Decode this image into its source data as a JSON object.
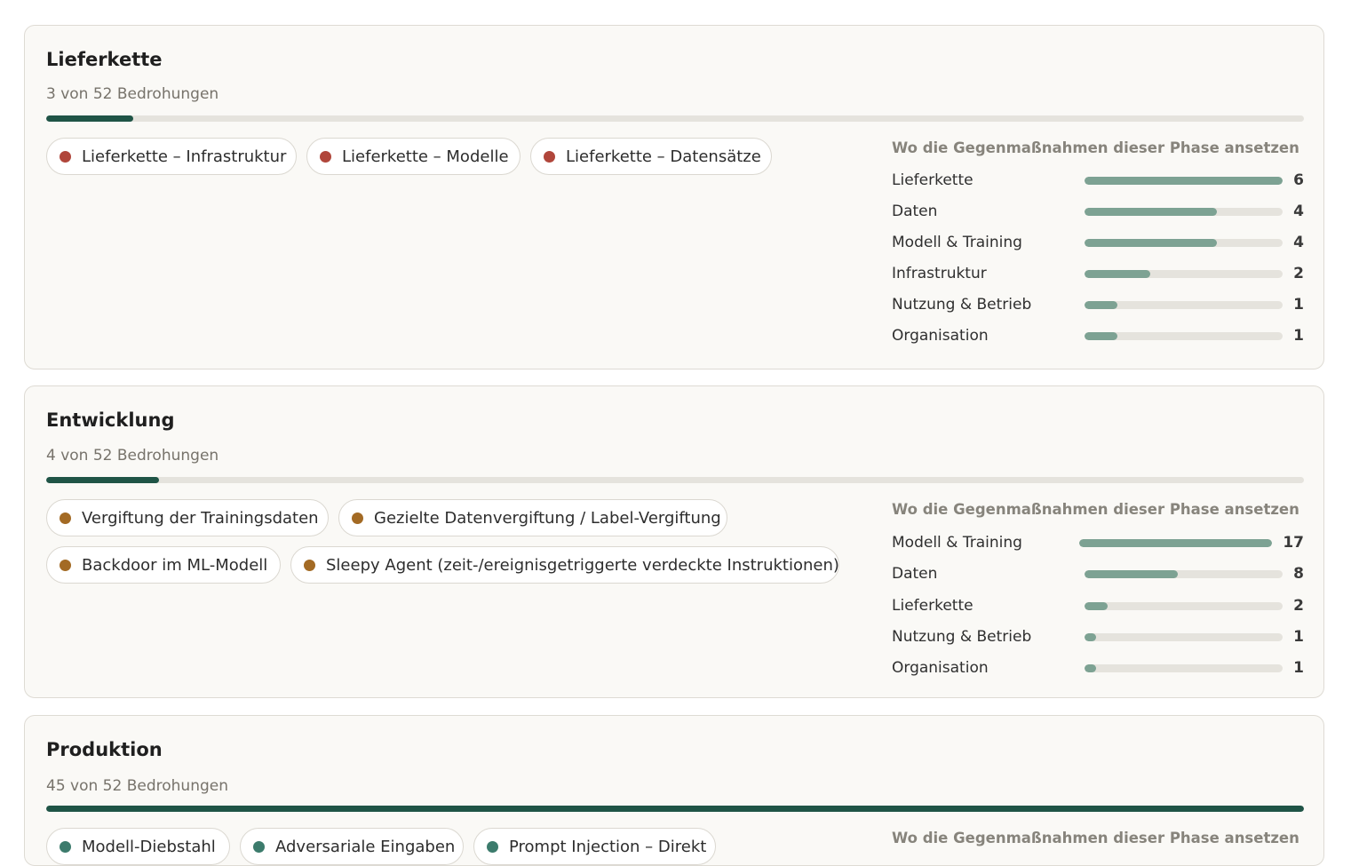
{
  "colors": {
    "phase_progress": "#1f5446",
    "bar_fill": "#7da293",
    "supply_dot": "#b0463b",
    "dev_dot": "#a36a24",
    "prod_dot": "#3c7b6c"
  },
  "phases": [
    {
      "title": "Lieferkette",
      "subtitle": "3 von 52 Bedrohungen",
      "progress": 0.069,
      "threats": [
        "Lieferkette – Infrastruktur",
        "Lieferkette – Modelle",
        "Lieferkette – Datensätze"
      ],
      "measures_title": "Wo die Gegenmaßnahmen dieser Phase ansetzen",
      "measures": [
        {
          "label": "Lieferkette",
          "count": 6
        },
        {
          "label": "Daten",
          "count": 4
        },
        {
          "label": "Modell & Training",
          "count": 4
        },
        {
          "label": "Infrastruktur",
          "count": 2
        },
        {
          "label": "Nutzung & Betrieb",
          "count": 1
        },
        {
          "label": "Organisation",
          "count": 1
        }
      ]
    },
    {
      "title": "Entwicklung",
      "subtitle": "4 von 52 Bedrohungen",
      "progress": 0.09,
      "threats": [
        "Vergiftung der Trainingsdaten",
        "Gezielte Datenvergiftung / Label-Vergiftung",
        "Backdoor im ML-Modell",
        "Sleepy Agent (zeit-/ereignisgetriggerte verdeckte Instruktionen)"
      ],
      "measures_title": "Wo die Gegenmaßnahmen dieser Phase ansetzen",
      "measures": [
        {
          "label": "Modell & Training",
          "count": 17
        },
        {
          "label": "Daten",
          "count": 8
        },
        {
          "label": "Lieferkette",
          "count": 2
        },
        {
          "label": "Nutzung & Betrieb",
          "count": 1
        },
        {
          "label": "Organisation",
          "count": 1
        }
      ]
    },
    {
      "title": "Produktion",
      "subtitle": "45 von 52 Bedrohungen",
      "progress": 1.0,
      "threats": [
        "Modell-Diebstahl",
        "Adversariale Eingaben",
        "Prompt Injection – Direkt"
      ],
      "measures_title": "Wo die Gegenmaßnahmen dieser Phase ansetzen"
    }
  ]
}
